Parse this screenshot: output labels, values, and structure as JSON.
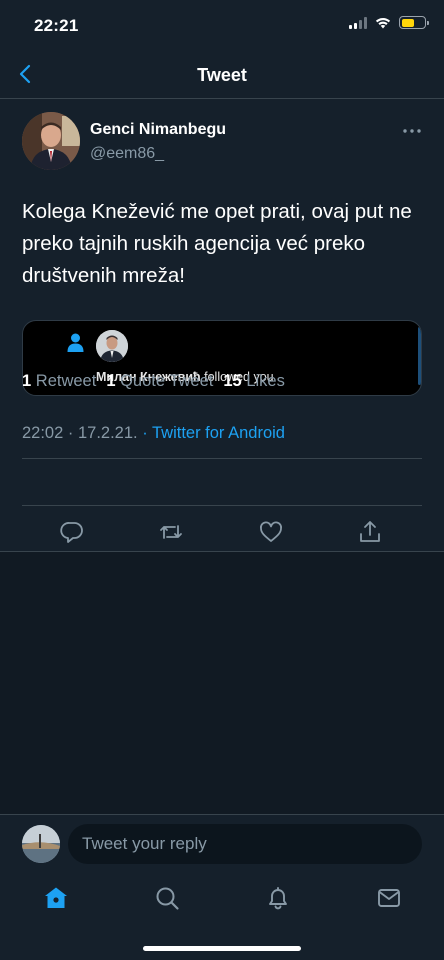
{
  "status_bar": {
    "time": "22:21"
  },
  "nav": {
    "title": "Tweet"
  },
  "tweet": {
    "author": {
      "display_name": "Genci Nimanbegu",
      "handle": "@eem86_"
    },
    "text": "Kolega Knežević me opet prati, ovaj put ne preko tajnih ruskih agencija već preko društvenih mreža!",
    "embed": {
      "name": "Милан Кнежевић",
      "action": "followed you"
    },
    "time": "22:02",
    "date": "17.2.21.",
    "source": "Twitter for Android",
    "stats": {
      "retweets": {
        "count": "1",
        "label": "Retweet"
      },
      "quote_tweets": {
        "count": "1",
        "label": "Quote Tweet"
      },
      "likes": {
        "count": "15",
        "label": "Likes"
      }
    },
    "actions": [
      "reply-icon",
      "retweet-icon",
      "like-icon",
      "share-icon"
    ]
  },
  "reply": {
    "placeholder": "Tweet your reply"
  },
  "tab_bar": {
    "items": [
      "home-icon",
      "search-icon",
      "notifications-icon",
      "messages-icon"
    ],
    "active": "home-icon"
  },
  "colors": {
    "background": "#15202b",
    "accent": "#1da1f2",
    "secondary_text": "#8899a6",
    "divider": "#38444d",
    "battery": "#ffd60a"
  },
  "battery_level": 0.55
}
